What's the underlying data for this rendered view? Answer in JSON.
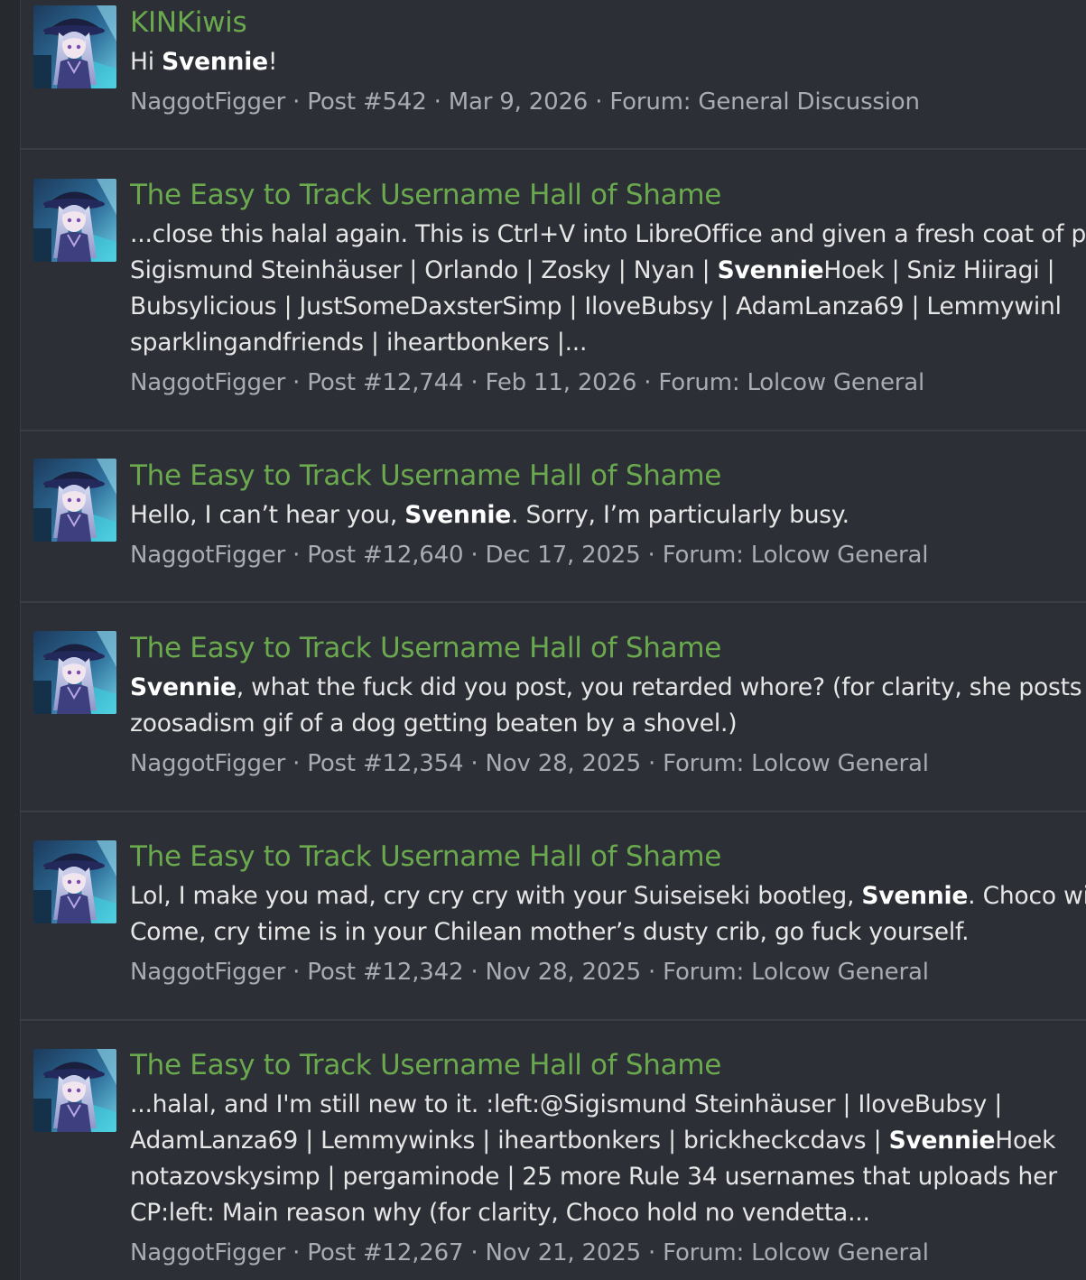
{
  "colors": {
    "page_background": "#2a2d33",
    "result_background": "#2c2f35",
    "divider": "#3a3d43",
    "title_green": "#6aa94e",
    "snippet_text": "#e6e6e6",
    "meta_text": "#a9adb3"
  },
  "results": [
    {
      "title": "KINKiwis",
      "snippet": [
        [
          {
            "t": "Hi "
          },
          {
            "t": "Svennie",
            "b": true
          },
          {
            "t": "!"
          }
        ]
      ],
      "meta": {
        "author": "NaggotFigger",
        "post": "Post #542",
        "date": "Mar 9, 2026",
        "forum": "Forum: General Discussion"
      }
    },
    {
      "title": "The Easy to Track Username Hall of Shame",
      "snippet": [
        [
          {
            "t": "...close this halal again. This is Ctrl+V into LibreOffice and given a fresh coat of pa"
          }
        ],
        [
          {
            "t": "Sigismund Steinhäuser | Orlando | Zosky | Nyan | "
          },
          {
            "t": "Svennie",
            "b": true
          },
          {
            "t": "Hoek | Sniz Hiiragi |"
          }
        ],
        [
          {
            "t": "Bubsylicious | JustSomeDaxsterSimp | IloveBubsy | AdamLanza69 | Lemmywinl"
          }
        ],
        [
          {
            "t": "sparklingandfriends | iheartbonkers |..."
          }
        ]
      ],
      "meta": {
        "author": "NaggotFigger",
        "post": "Post #12,744",
        "date": "Feb 11, 2026",
        "forum": "Forum: Lolcow General"
      }
    },
    {
      "title": "The Easy to Track Username Hall of Shame",
      "snippet": [
        [
          {
            "t": "Hello, I can’t hear you, "
          },
          {
            "t": "Svennie",
            "b": true
          },
          {
            "t": ". Sorry, I’m particularly busy."
          }
        ]
      ],
      "meta": {
        "author": "NaggotFigger",
        "post": "Post #12,640",
        "date": "Dec 17, 2025",
        "forum": "Forum: Lolcow General"
      }
    },
    {
      "title": "The Easy to Track Username Hall of Shame",
      "snippet": [
        [
          {
            "t": "Svennie",
            "b": true
          },
          {
            "t": ", what the fuck did you post, you retarded whore? (for clarity, she posts a"
          }
        ],
        [
          {
            "t": "zoosadism gif of a dog getting beaten by a shovel.)"
          }
        ]
      ],
      "meta": {
        "author": "NaggotFigger",
        "post": "Post #12,354",
        "date": "Nov 28, 2025",
        "forum": "Forum: Lolcow General"
      }
    },
    {
      "title": "The Easy to Track Username Hall of Shame",
      "snippet": [
        [
          {
            "t": "Lol, I make you mad, cry cry cry with your Suiseiseki bootleg, "
          },
          {
            "t": "Svennie",
            "b": true
          },
          {
            "t": ". Choco win"
          }
        ],
        [
          {
            "t": "Come, cry time is in your Chilean mother’s dusty crib, go fuck yourself."
          }
        ]
      ],
      "meta": {
        "author": "NaggotFigger",
        "post": "Post #12,342",
        "date": "Nov 28, 2025",
        "forum": "Forum: Lolcow General"
      }
    },
    {
      "title": "The Easy to Track Username Hall of Shame",
      "snippet": [
        [
          {
            "t": "...halal, and I'm still new to it. :left:@Sigismund Steinhäuser | IloveBubsy |"
          }
        ],
        [
          {
            "t": "AdamLanza69 | Lemmywinks | iheartbonkers | brickheckcdavs | "
          },
          {
            "t": "Svennie",
            "b": true
          },
          {
            "t": "Hoek"
          }
        ],
        [
          {
            "t": "notazovskysimp | pergaminode | 25 more Rule 34 usernames that uploads her"
          }
        ],
        [
          {
            "t": "CP:left: Main reason why (for clarity, Choco hold no vendetta..."
          }
        ]
      ],
      "meta": {
        "author": "NaggotFigger",
        "post": "Post #12,267",
        "date": "Nov 21, 2025",
        "forum": "Forum: Lolcow General"
      }
    }
  ]
}
